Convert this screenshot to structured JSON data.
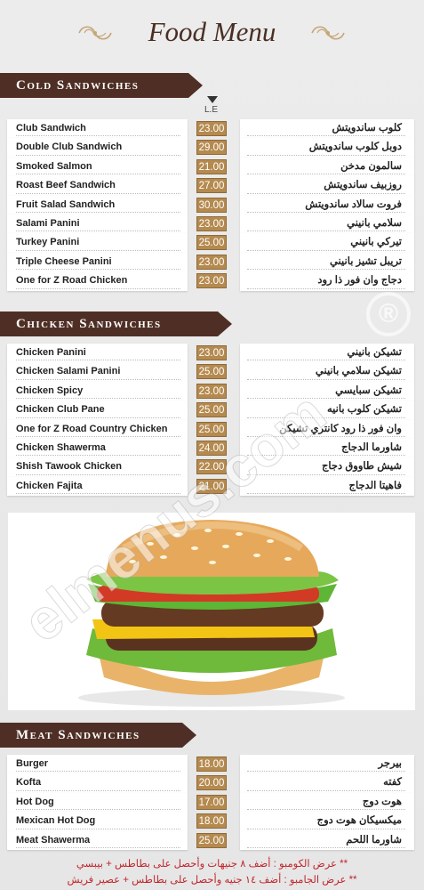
{
  "title": "Food Menu",
  "currency_label": "L.E",
  "sections": {
    "cold": {
      "heading": "Cold Sandwiches",
      "items": [
        {
          "en": "Club Sandwich",
          "ar": "كلوب ساندويتش",
          "price": "23.00"
        },
        {
          "en": "Double Club Sandwich",
          "ar": "دوبل كلوب ساندويتش",
          "price": "29.00"
        },
        {
          "en": "Smoked Salmon",
          "ar": "سالمون مدخن",
          "price": "21.00"
        },
        {
          "en": "Roast Beef Sandwich",
          "ar": "روزبيف ساندويتش",
          "price": "27.00"
        },
        {
          "en": "Fruit Salad Sandwich",
          "ar": "فروت سالاد ساندويتش",
          "price": "30.00"
        },
        {
          "en": "Salami Panini",
          "ar": "سلامي بانيني",
          "price": "23.00"
        },
        {
          "en": "Turkey Panini",
          "ar": "تيركي بانيني",
          "price": "25.00"
        },
        {
          "en": "Triple Cheese Panini",
          "ar": "تريبل تشيز بانيني",
          "price": "23.00"
        },
        {
          "en": "One for Z Road Chicken",
          "ar": "دجاج وان فور ذا رود",
          "price": "23.00"
        }
      ]
    },
    "chicken": {
      "heading": "Chicken Sandwiches",
      "items": [
        {
          "en": "Chicken Panini",
          "ar": "تشيكن بانيني",
          "price": "23.00"
        },
        {
          "en": "Chicken Salami Panini",
          "ar": "تشيكن سلامي بانيني",
          "price": "25.00"
        },
        {
          "en": "Chicken Spicy",
          "ar": "تشيكن سبايسي",
          "price": "23.00"
        },
        {
          "en": "Chicken Club Pane",
          "ar": "تشيكن كلوب بانيه",
          "price": "25.00"
        },
        {
          "en": "One for Z Road Country Chicken",
          "ar": "وان فور ذا رود كانتري تشيكن",
          "price": "25.00"
        },
        {
          "en": "Chicken Shawerma",
          "ar": "شاورما الدجاج",
          "price": "24.00"
        },
        {
          "en": "Shish Tawook Chicken",
          "ar": "شيش طاووق دجاج",
          "price": "22.00"
        },
        {
          "en": "Chicken Fajita",
          "ar": "فاهيتا الدجاج",
          "price": "21.00"
        }
      ]
    },
    "meat": {
      "heading": "Meat Sandwiches",
      "items": [
        {
          "en": "Burger",
          "ar": "بيرجر",
          "price": "18.00"
        },
        {
          "en": "Kofta",
          "ar": "كفته",
          "price": "20.00"
        },
        {
          "en": "Hot Dog",
          "ar": "هوت دوج",
          "price": "17.00"
        },
        {
          "en": "Mexican Hot Dog",
          "ar": "ميكسيكان هوت دوج",
          "price": "18.00"
        },
        {
          "en": "Meat Shawerma",
          "ar": "شاورما اللحم",
          "price": "25.00"
        }
      ]
    }
  },
  "notes": [
    "** عرض الكومبو : أضف ٨ جنيهات وأحصل على بطاطس + بيبسي",
    "** عرض الجامبو : أضف ١٤ جنيه وأحصل على بطاطس + عصير فريش"
  ],
  "watermark": "elmenus.com",
  "colors": {
    "banner": "#4f2f25",
    "price_bg": "#b58a4f",
    "note": "#c0272d"
  }
}
